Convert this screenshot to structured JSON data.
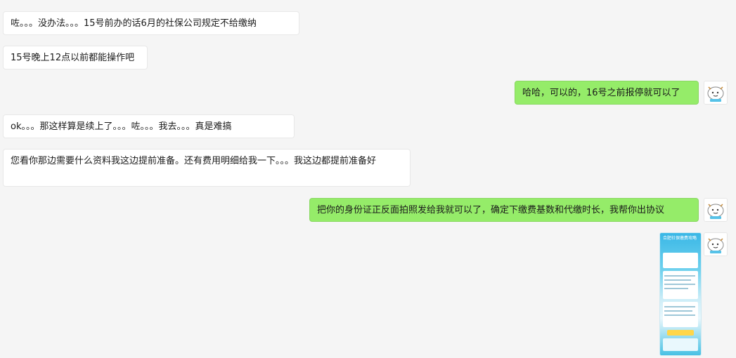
{
  "messages": [
    {
      "side": "in",
      "text": "咗。。。没办法。。。15号前办的话6月的社保公司规定不给缴纳"
    },
    {
      "side": "in",
      "text": "15号晚上12点以前都能操作吧"
    },
    {
      "side": "out",
      "text": "哈哈，可以的，16号之前报停就可以了"
    },
    {
      "side": "in",
      "text": "ok。。。那这样算是续上了。。。咗。。。我去。。。真是难搞"
    },
    {
      "side": "in",
      "text": "您看你那边需要什么资料我这边提前准备。还有费用明细给我一下。。。我这边都提前准备好"
    },
    {
      "side": "out",
      "text": "把你的身份证正反面拍照发给我就可以了，确定下缴费基数和代缴时长，我帮你出协议"
    }
  ],
  "image_message": {
    "side": "out",
    "thumb_title": "合肥社保缴费攻略"
  },
  "colors": {
    "background": "#f5f5f5",
    "outgoing": "#95ec69",
    "incoming": "#ffffff"
  },
  "icons": {
    "avatar": "cartoon-avatar-icon"
  }
}
